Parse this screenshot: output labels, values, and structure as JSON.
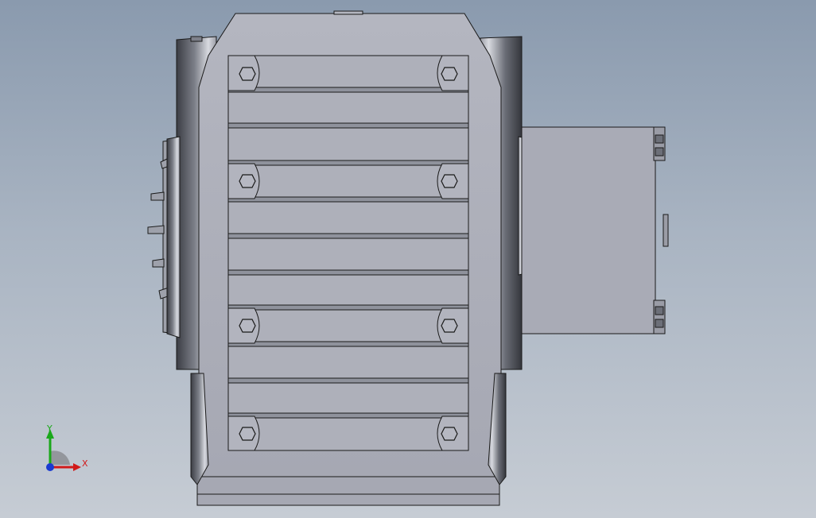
{
  "viewport": {
    "background_top": "#8a9aae",
    "background_bottom": "#c6ccd4"
  },
  "model": {
    "name": "gear-reducer-assembly",
    "view": "front-orthographic",
    "body_color": "#a9abb6",
    "edge_color": "#1a1a1a"
  },
  "triad": {
    "x_label": "X",
    "y_label": "Y",
    "x_color": "#d11a1a",
    "y_color": "#1aa81a",
    "z_color": "#1a3ad1"
  }
}
